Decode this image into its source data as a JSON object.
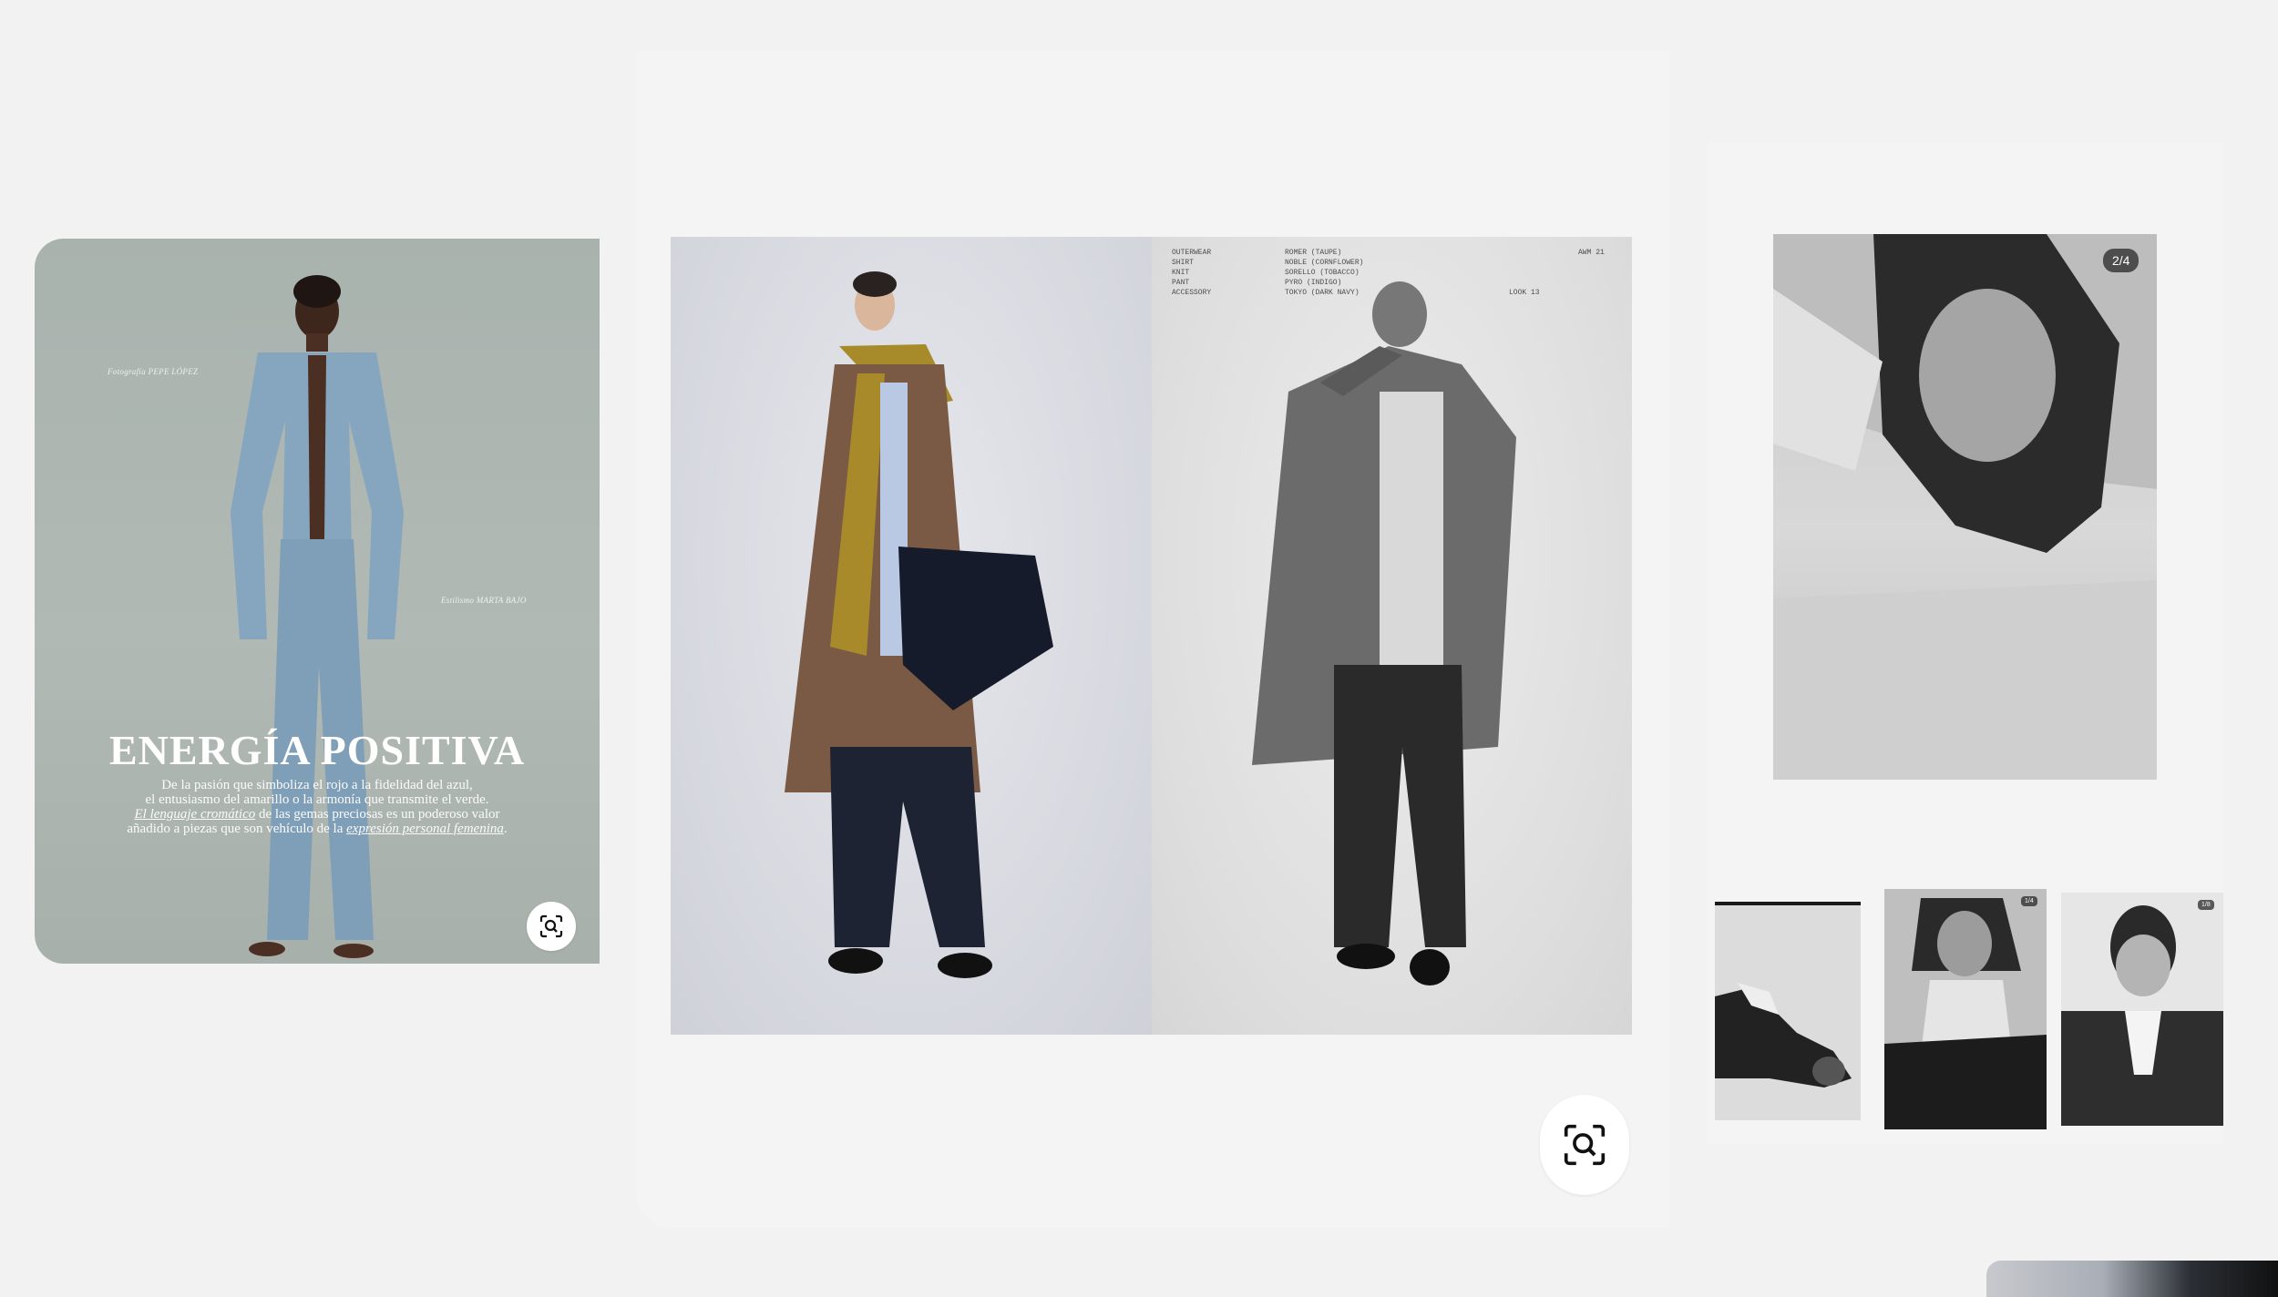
{
  "pins": {
    "left": {
      "photographer_credit": "Fotografía PEPE LÓPEZ",
      "stylist_credit": "Estilismo MARTA BAJO",
      "headline": "ENERGÍA POSITIVA",
      "deck_line1": "De la pasión que simboliza el rojo a la fidelidad del azul,",
      "deck_line2": "el entusiasmo del amarillo o la armonía que transmite el verde.",
      "deck_line3_em": "El lenguaje cromático",
      "deck_line3_rest": " de las gemas preciosas es un poderoso valor",
      "deck_line4_start": "añadido a piezas que son vehículo de la ",
      "deck_line4_em": "expresión personal femenina",
      "deck_line4_end": "."
    },
    "center": {
      "spec_labels": "OUTERWEAR\nSHIRT\nKNIT\nPANT\nACCESSORY",
      "spec_values": "ROMER (TAUPE)\nNOBLE (CORNFLOWER)\nSORELLO (TOBACCO)\nPYRO (INDIGO)\nTOKYO (DARK NAVY)",
      "season": "AWM 21",
      "look": "LOOK 13"
    },
    "right": {
      "counter": "2/4",
      "thumb_badge_a": "1/4",
      "thumb_badge_b": "1/8"
    }
  },
  "icons": {
    "lens_left": "visual-search-icon",
    "lens_center": "visual-search-icon"
  },
  "colors": {
    "background": "#f2f2f2",
    "card": "#f4f4f4",
    "button": "#ffffff"
  }
}
